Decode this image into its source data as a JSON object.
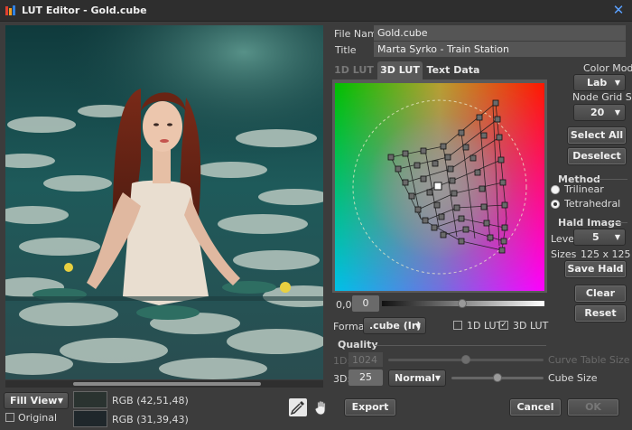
{
  "window": {
    "title": "LUT Editor - Gold.cube",
    "close_icon": "close-icon",
    "accent": "#5aa0ff"
  },
  "file": {
    "file_name_label": "File Name",
    "file_name": "Gold.cube",
    "title_label": "Title",
    "title": "Marta Syrko - Train Station"
  },
  "tabs": [
    {
      "label": "1D LUT",
      "state": "disabled"
    },
    {
      "label": "3D LUT",
      "state": "active"
    },
    {
      "label": "Text Data",
      "state": "normal"
    }
  ],
  "color_model": {
    "label": "Color Model",
    "value": "Lab"
  },
  "node_grid": {
    "label": "Node Grid Size",
    "value": "20"
  },
  "buttons": {
    "select_all": "Select All",
    "deselect": "Deselect",
    "save_hald": "Save Hald",
    "clear": "Clear",
    "reset": "Reset",
    "export": "Export",
    "cancel": "Cancel",
    "ok": "OK"
  },
  "method": {
    "label": "Method",
    "options": [
      {
        "label": "Trilinear",
        "selected": false
      },
      {
        "label": "Tetrahedral",
        "selected": true
      }
    ]
  },
  "hald": {
    "label": "Hald Image",
    "level_label": "Level",
    "level": "5",
    "sizes_label": "Sizes",
    "sizes": "125 x 125"
  },
  "luminance": {
    "label": "0,0",
    "value": "0"
  },
  "format": {
    "label": "Format",
    "value": ".cube (Ir)",
    "check_1d": {
      "label": "1D LUT",
      "checked": false
    },
    "check_3d": {
      "label": "3D LUT",
      "checked": true
    }
  },
  "quality": {
    "label": "Quality",
    "row_1d": {
      "label": "1D:",
      "value": "1024",
      "slider_caption": "Curve Table Size",
      "enabled": false
    },
    "row_3d": {
      "label": "3D:",
      "value": "25",
      "preset": "Normal",
      "slider_caption": "Cube Size",
      "enabled": true
    }
  },
  "view": {
    "mode": "Fill View",
    "original_label": "Original",
    "original_checked": false,
    "rgb_top": "RGB (42,51,48)",
    "rgb_bottom": "RGB (31,39,43)",
    "swatch_top": "#2a3330",
    "swatch_bottom": "#1f272b"
  },
  "tools": {
    "eyedropper": "eyedropper-icon",
    "hand": "hand-icon"
  }
}
